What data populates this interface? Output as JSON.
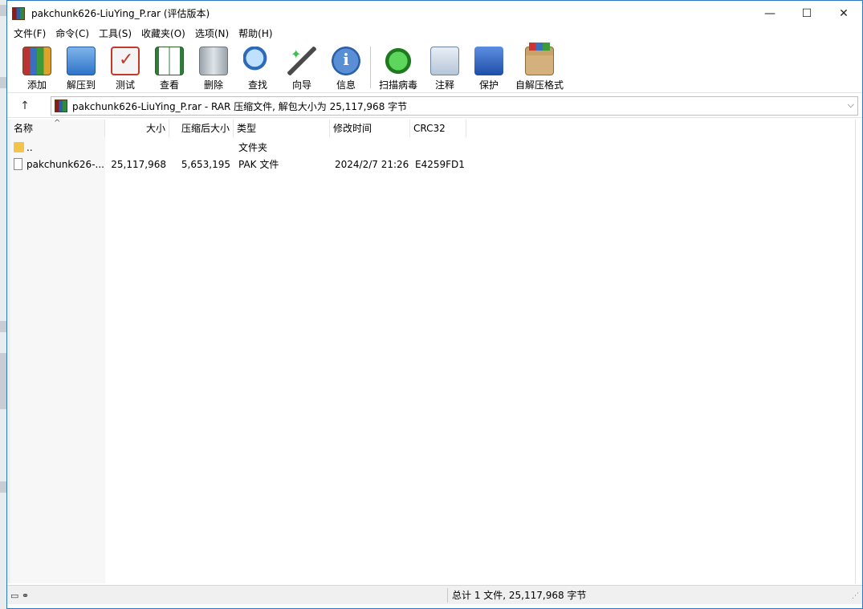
{
  "window": {
    "title": "pakchunk626-LiuYing_P.rar (评估版本)"
  },
  "controls": {
    "minimize": "—",
    "maximize": "☐",
    "close": "✕"
  },
  "menu": [
    "文件(F)",
    "命令(C)",
    "工具(S)",
    "收藏夹(O)",
    "选项(N)",
    "帮助(H)"
  ],
  "toolbar": [
    {
      "label": "添加",
      "icon": "add-icon"
    },
    {
      "label": "解压到",
      "icon": "extract-icon"
    },
    {
      "label": "测试",
      "icon": "test-icon"
    },
    {
      "label": "查看",
      "icon": "view-icon"
    },
    {
      "label": "删除",
      "icon": "delete-icon"
    },
    {
      "label": "查找",
      "icon": "find-icon"
    },
    {
      "label": "向导",
      "icon": "wizard-icon"
    },
    {
      "label": "信息",
      "icon": "info-icon"
    },
    {
      "label": "扫描病毒",
      "icon": "virus-scan-icon"
    },
    {
      "label": "注释",
      "icon": "comment-icon"
    },
    {
      "label": "保护",
      "icon": "protect-icon"
    },
    {
      "label": "自解压格式",
      "icon": "sfx-icon"
    }
  ],
  "address": {
    "up": "↑",
    "path": "pakchunk626-LiuYing_P.rar - RAR 压缩文件, 解包大小为 25,117,968 字节",
    "dropdown": "⌵"
  },
  "columns": {
    "name": "名称",
    "size": "大小",
    "packed": "压缩后大小",
    "type": "类型",
    "modified": "修改时间",
    "crc": "CRC32",
    "sort_indicator": "^"
  },
  "rows": [
    {
      "name": "..",
      "size": "",
      "packed": "",
      "type": "文件夹",
      "modified": "",
      "crc": ""
    },
    {
      "name": "pakchunk626-...",
      "size": "25,117,968",
      "packed": "5,653,195",
      "type": "PAK 文件",
      "modified": "2024/2/7 21:26",
      "crc": "E4259FD1"
    }
  ],
  "status": {
    "icons": "▭ ⚭",
    "text": "总计 1 文件, 25,117,968 字节"
  }
}
